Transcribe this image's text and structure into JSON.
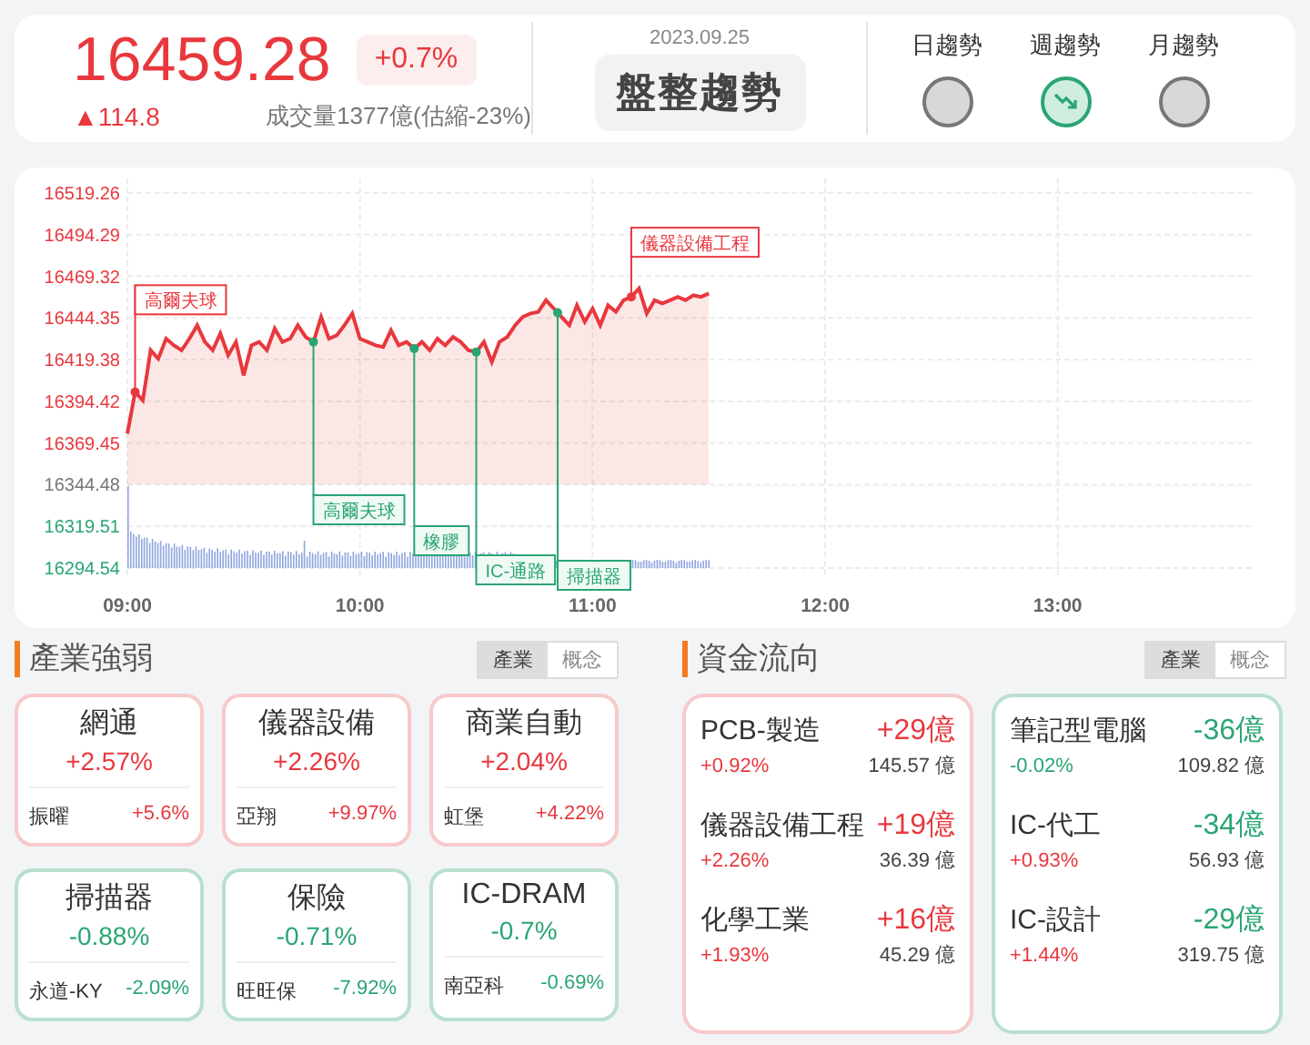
{
  "header": {
    "price": "16459.28",
    "change_percent": "+0.7%",
    "change": "▲114.8",
    "volume": "成交量1377億(估縮-23%)",
    "date": "2023.09.25",
    "trend_label": "盤整趨勢",
    "trends": [
      {
        "label": "日趨勢",
        "falling": false
      },
      {
        "label": "週趨勢",
        "falling": true
      },
      {
        "label": "月趨勢",
        "falling": false
      }
    ]
  },
  "chart": {
    "chart_data": {
      "type": "area",
      "categories": [
        "09:00",
        null,
        null,
        null,
        null,
        null,
        null,
        null,
        null,
        null,
        null,
        null,
        null,
        null,
        null,
        null,
        null,
        null,
        null,
        null,
        null,
        null,
        null,
        null,
        null,
        null,
        null,
        null,
        null,
        null,
        "10:00",
        null,
        null,
        null,
        null,
        null,
        null,
        null,
        null,
        null,
        null,
        null,
        null,
        null,
        null,
        null,
        null,
        null,
        null,
        null,
        null,
        null,
        null,
        null,
        null,
        null,
        null,
        null,
        null,
        null,
        "11:00",
        null,
        null,
        null,
        null,
        null,
        null,
        null,
        null,
        null,
        null,
        null,
        null,
        null,
        null,
        null,
        null,
        null,
        null,
        null,
        null,
        null,
        null,
        null,
        null,
        null,
        null,
        null,
        null,
        null,
        "12:00",
        null,
        null,
        null,
        null,
        null,
        null,
        null,
        null,
        null,
        null,
        null,
        null,
        null,
        null,
        null,
        null,
        null,
        null,
        null,
        null,
        null,
        null,
        null,
        null,
        null,
        null,
        null,
        null,
        null,
        "13:00",
        null,
        null,
        null,
        null,
        null,
        null,
        null,
        null,
        null,
        null,
        null,
        null,
        null,
        null,
        null
      ],
      "series": [
        {
          "color": "#e8383d",
          "values": [
            16375,
            16400,
            16395,
            16425,
            16420,
            16432,
            16428,
            16425,
            16432,
            16440,
            16430,
            16425,
            16435,
            16422,
            16430,
            16410,
            16428,
            16430,
            16425,
            16438,
            16430,
            16432,
            16440,
            16433,
            16430,
            16445,
            16432,
            16434,
            16440,
            16447,
            16432,
            16430,
            16428,
            16427,
            16437,
            16428,
            16430,
            16426,
            16430,
            16425,
            16432,
            16428,
            16433,
            16430,
            16425,
            16424,
            16430,
            16418,
            16430,
            16433,
            16440,
            16445,
            16447,
            16448,
            16455,
            16450,
            16445,
            16440,
            16452,
            16442,
            16450,
            16440,
            16452,
            16448,
            16455,
            16457,
            16462,
            16447,
            16455,
            16453,
            16455,
            16457,
            16455,
            16458,
            16457,
            16459,
            null,
            null,
            null,
            null,
            null,
            null,
            null,
            null,
            null,
            null,
            null,
            null,
            null,
            null,
            null,
            null,
            null,
            null,
            null,
            null,
            null,
            null,
            null,
            null,
            null,
            null,
            null,
            null,
            null,
            null,
            null,
            null,
            null,
            null,
            null,
            null,
            null,
            null,
            null,
            null,
            null,
            null,
            null,
            null,
            null,
            null,
            null,
            null,
            null,
            null,
            null,
            null,
            null,
            null,
            null,
            null,
            null,
            null,
            null,
            null
          ]
        }
      ],
      "ylim": [
        16294.54,
        16519.26
      ],
      "grid": true,
      "yticks": [
        {
          "value": 16519.26,
          "label": "16519.26"
        },
        {
          "value": 16494.29,
          "label": "16494.29"
        },
        {
          "value": 16469.32,
          "label": "16469.32"
        },
        {
          "value": 16444.35,
          "label": "16444.35"
        },
        {
          "value": 16419.38,
          "label": "16419.38"
        },
        {
          "value": 16394.42,
          "label": "16394.42"
        },
        {
          "value": 16369.45,
          "label": "16369.45"
        },
        {
          "value": 16344.48,
          "label": "16344.48"
        },
        {
          "value": 16319.51,
          "label": "16319.51"
        },
        {
          "value": 16294.54,
          "label": "16294.54"
        }
      ]
    },
    "markers": [
      {
        "text": "高爾夫球",
        "rising": true
      },
      {
        "text": "高爾夫球",
        "rising": false
      },
      {
        "text": "橡膠",
        "rising": false
      },
      {
        "text": "IC-通路",
        "rising": false
      },
      {
        "text": "掃描器",
        "rising": false
      },
      {
        "text": "儀器設備工程",
        "rising": true
      }
    ]
  },
  "industry": {
    "title": "產業強弱",
    "toggle": [
      {
        "label": "產業",
        "selected": true
      },
      {
        "label": "概念",
        "selected": false
      }
    ],
    "cards": [
      {
        "name": "網通",
        "percent": "+2.57%",
        "rising": true,
        "stock": "振曜",
        "stock_percent": "+5.6%"
      },
      {
        "name": "儀器設備",
        "percent": "+2.26%",
        "rising": true,
        "stock": "亞翔",
        "stock_percent": "+9.97%"
      },
      {
        "name": "商業自動",
        "percent": "+2.04%",
        "rising": true,
        "stock": "虹堡",
        "stock_percent": "+4.22%"
      },
      {
        "name": "掃描器",
        "percent": "-0.88%",
        "rising": false,
        "stock": "永道-KY",
        "stock_percent": "-2.09%"
      },
      {
        "name": "保險",
        "percent": "-0.71%",
        "rising": false,
        "stock": "旺旺保",
        "stock_percent": "-7.92%"
      },
      {
        "name": "IC-DRAM",
        "percent": "-0.7%",
        "rising": false,
        "stock": "南亞科",
        "stock_percent": "-0.69%"
      }
    ]
  },
  "fund_flow": {
    "title": "資金流向",
    "toggle": [
      {
        "label": "產業",
        "selected": true
      },
      {
        "label": "概念",
        "selected": false
      }
    ],
    "cards": [
      {
        "inflow": true,
        "items": [
          {
            "name": "PCB-製造",
            "flow": "+29億",
            "percent": "+0.92%",
            "percent_rising": true,
            "amount": "145.57 億"
          },
          {
            "name": "儀器設備工程",
            "flow": "+19億",
            "percent": "+2.26%",
            "percent_rising": true,
            "amount": "36.39 億"
          },
          {
            "name": "化學工業",
            "flow": "+16億",
            "percent": "+1.93%",
            "percent_rising": true,
            "amount": "45.29 億"
          }
        ]
      },
      {
        "inflow": false,
        "items": [
          {
            "name": "筆記型電腦",
            "flow": "-36億",
            "percent": "-0.02%",
            "percent_rising": false,
            "amount": "109.82 億"
          },
          {
            "name": "IC-代工",
            "flow": "-34億",
            "percent": "+0.93%",
            "percent_rising": true,
            "amount": "56.93 億"
          },
          {
            "name": "IC-設計",
            "flow": "-29億",
            "percent": "+1.44%",
            "percent_rising": true,
            "amount": "319.75 億"
          }
        ]
      }
    ]
  }
}
